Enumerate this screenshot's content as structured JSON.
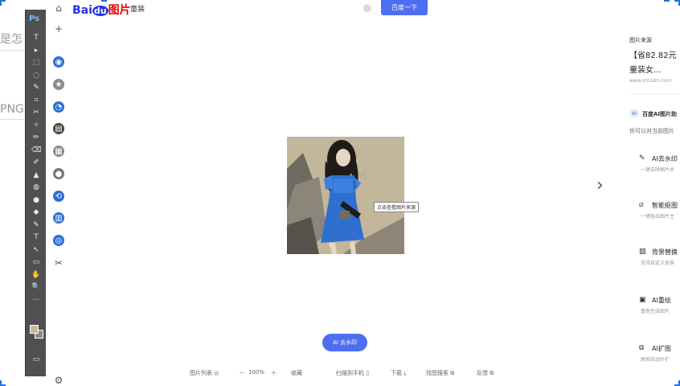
{
  "left_snippets": {
    "line1": "是怎",
    "line2": "PNG"
  },
  "photoshop": {
    "logo": "Ps",
    "tools": [
      "T",
      "▸",
      "⬚",
      "◌",
      "✎",
      "⌗",
      "✂",
      "✧",
      "✏",
      "⌫",
      "✐",
      "▲",
      "◍",
      "●",
      "◆",
      "✎",
      "T",
      "↖",
      "▭",
      "✋",
      "🔍",
      "⋯"
    ]
  },
  "header": {
    "logo_bai": "Bai",
    "logo_du": "du",
    "logo_suffix": "图片",
    "query": "童装",
    "search_button": "百度一下"
  },
  "rail": {
    "icons": [
      {
        "name": "home-icon",
        "glyph": "⌂"
      },
      {
        "name": "add-icon",
        "glyph": "+"
      },
      {
        "name": "app-icon-1",
        "glyph": "◉"
      },
      {
        "name": "app-icon-2",
        "glyph": "★"
      },
      {
        "name": "app-icon-3",
        "glyph": "◔"
      },
      {
        "name": "app-icon-4",
        "glyph": "▤"
      },
      {
        "name": "app-icon-5",
        "glyph": "▦"
      },
      {
        "name": "app-icon-6",
        "glyph": "●"
      },
      {
        "name": "app-icon-7",
        "glyph": "⟲"
      },
      {
        "name": "app-icon-8",
        "glyph": "▥"
      },
      {
        "name": "app-icon-9",
        "glyph": "◎"
      },
      {
        "name": "scissors-icon",
        "glyph": "✂"
      },
      {
        "name": "settings-icon",
        "glyph": "⚙"
      }
    ]
  },
  "viewer": {
    "tooltip": "点击查看图片来源",
    "ai_button": "AI 去水印",
    "next_arrow": "›"
  },
  "bottom_bar": {
    "list": "图片列表 ◎",
    "zoom_out": "－",
    "zoom": "100%",
    "zoom_in": "＋",
    "fav": "收藏",
    "scan": "扫描到手机 ▯",
    "download": "下载 ⤓",
    "similar": "找图搜索 ⧉",
    "feedback": "反馈 ⧉"
  },
  "right_panel": {
    "source_label": "图片来源",
    "source_title_1": "【省82.82元",
    "source_title_2": "童装女...",
    "source_url": "www.smzdm.com",
    "ai_heading": "百度AI图片助",
    "ai_sub": "你可以对当前图片",
    "tools": [
      {
        "icon": "✎",
        "name": "AI去水印",
        "desc": "一键去除图片水"
      },
      {
        "icon": "⧄",
        "name": "智能抠图",
        "desc": "一键抠出图片主"
      },
      {
        "icon": "▨",
        "name": "背景替换",
        "desc": "支持自定义背景"
      },
      {
        "icon": "▣",
        "name": "AI重绘",
        "desc": "重新生成图片"
      },
      {
        "icon": "⧉",
        "name": "AI扩图",
        "desc": "原图自动外扩"
      }
    ]
  },
  "colors": {
    "accent": "#4e6ef2",
    "ps_toolbar": "#505050",
    "photo_bg": "#c2b69b",
    "dress": "#2f6fd0"
  }
}
